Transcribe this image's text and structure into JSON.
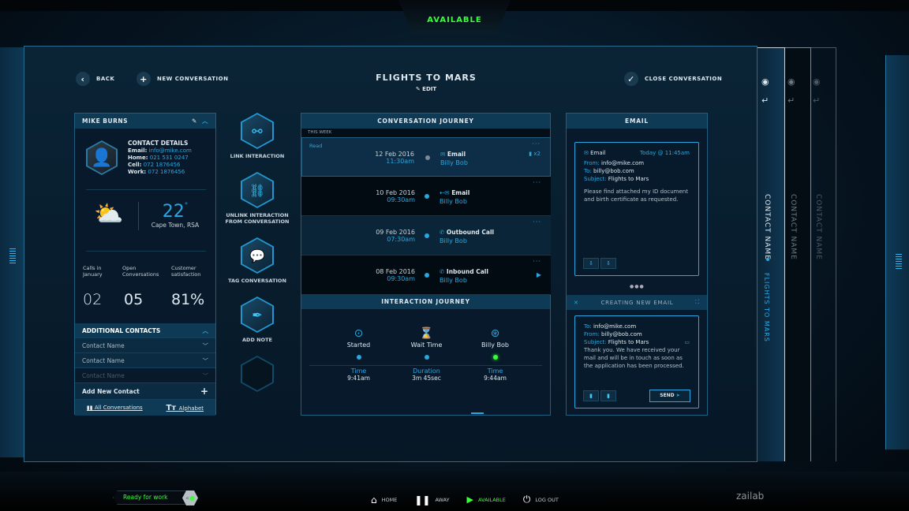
{
  "status_tab": "AVAILABLE",
  "header": {
    "back": "BACK",
    "new_conversation": "NEW CONVERSATION",
    "title": "FLIGHTS TO MARS",
    "edit": "EDIT",
    "close_conversation": "CLOSE CONVERSATION"
  },
  "contact": {
    "name": "MIKE BURNS",
    "details_title": "CONTACT DETAILS",
    "fields": [
      {
        "label": "Email:",
        "value": "info@mike.com"
      },
      {
        "label": "Home:",
        "value": "021 531 0247"
      },
      {
        "label": "Cell:",
        "value": "072 1876456"
      },
      {
        "label": "Work:",
        "value": "072 1876456"
      }
    ],
    "weather": {
      "temp": "22",
      "unit": "°",
      "location": "Cape Town, RSA"
    },
    "stats": [
      {
        "label": "Calls in January",
        "value": "02"
      },
      {
        "label": "Open Conversations",
        "value": "05"
      },
      {
        "label": "Customer satisfaction",
        "value": "81%"
      }
    ],
    "additional_title": "ADDITIONAL CONTACTS",
    "additional": [
      "Contact Name",
      "Contact Name",
      "Contact Name"
    ],
    "add_new": "Add New Contact",
    "footer": {
      "all": "All Conversations",
      "alphabet": "Alphabet"
    }
  },
  "actions": [
    "LINK INTERACTION",
    "UNLINK INTERACTION FROM CONVERSATION",
    "TAG CONVERSATION",
    "ADD NOTE"
  ],
  "conversation": {
    "title": "CONVERSATION JOURNEY",
    "section": "THIS WEEK",
    "read": "Read",
    "attach_count": "x2",
    "items": [
      {
        "date": "12 Feb 2016",
        "time": "11:30am",
        "type": "Email",
        "who": "Billy Bob"
      },
      {
        "date": "10 Feb 2016",
        "time": "09:30am",
        "type": "Email",
        "who": "Billy Bob"
      },
      {
        "date": "09 Feb 2016",
        "time": "07:30am",
        "type": "Outbound Call",
        "who": "Billy Bob"
      },
      {
        "date": "08 Feb 2016",
        "time": "09:30am",
        "type": "Inbound Call",
        "who": "Billy Bob"
      }
    ]
  },
  "interaction": {
    "title": "INTERACTION JOURNEY",
    "steps": [
      {
        "label": "Started",
        "k": "Time",
        "v": "9:41am"
      },
      {
        "label": "Wait Time",
        "k": "Duration",
        "v": "3m 45sec"
      },
      {
        "label": "Billy Bob",
        "k": "Time",
        "v": "9:44am"
      }
    ]
  },
  "email": {
    "title": "EMAIL",
    "type": "Email",
    "when": "Today @ 11:45am",
    "from_k": "From:",
    "from": "info@mike.com",
    "to_k": "To:",
    "to": "billy@bob.com",
    "subj_k": "Subject:",
    "subject": "Flights to Mars",
    "body": "Please find attached my ID document and birth certificate as requested.",
    "new_title": "CREATING NEW EMAIL",
    "new_to": "info@mike.com",
    "new_from": "billy@bob.com",
    "new_subject": "Flights to Mars",
    "new_body": "Thank you. We have received your mail and will be in touch as soon as the application has been processed.",
    "send": "SEND"
  },
  "tabs": [
    {
      "name": "CONTACT NAME",
      "sub": "FLIGHTS TO MARS"
    },
    {
      "name": "CONTACT NAME"
    },
    {
      "name": "CONTACT NAME"
    }
  ],
  "bottom": {
    "ready": "Ready for work",
    "home": "HOME",
    "away": "AWAY",
    "available": "AVAILABLE",
    "logout": "LOG OUT",
    "brand": "zailab"
  },
  "colors": {
    "accent": "#2aa7e0",
    "available": "#39ff3a"
  }
}
